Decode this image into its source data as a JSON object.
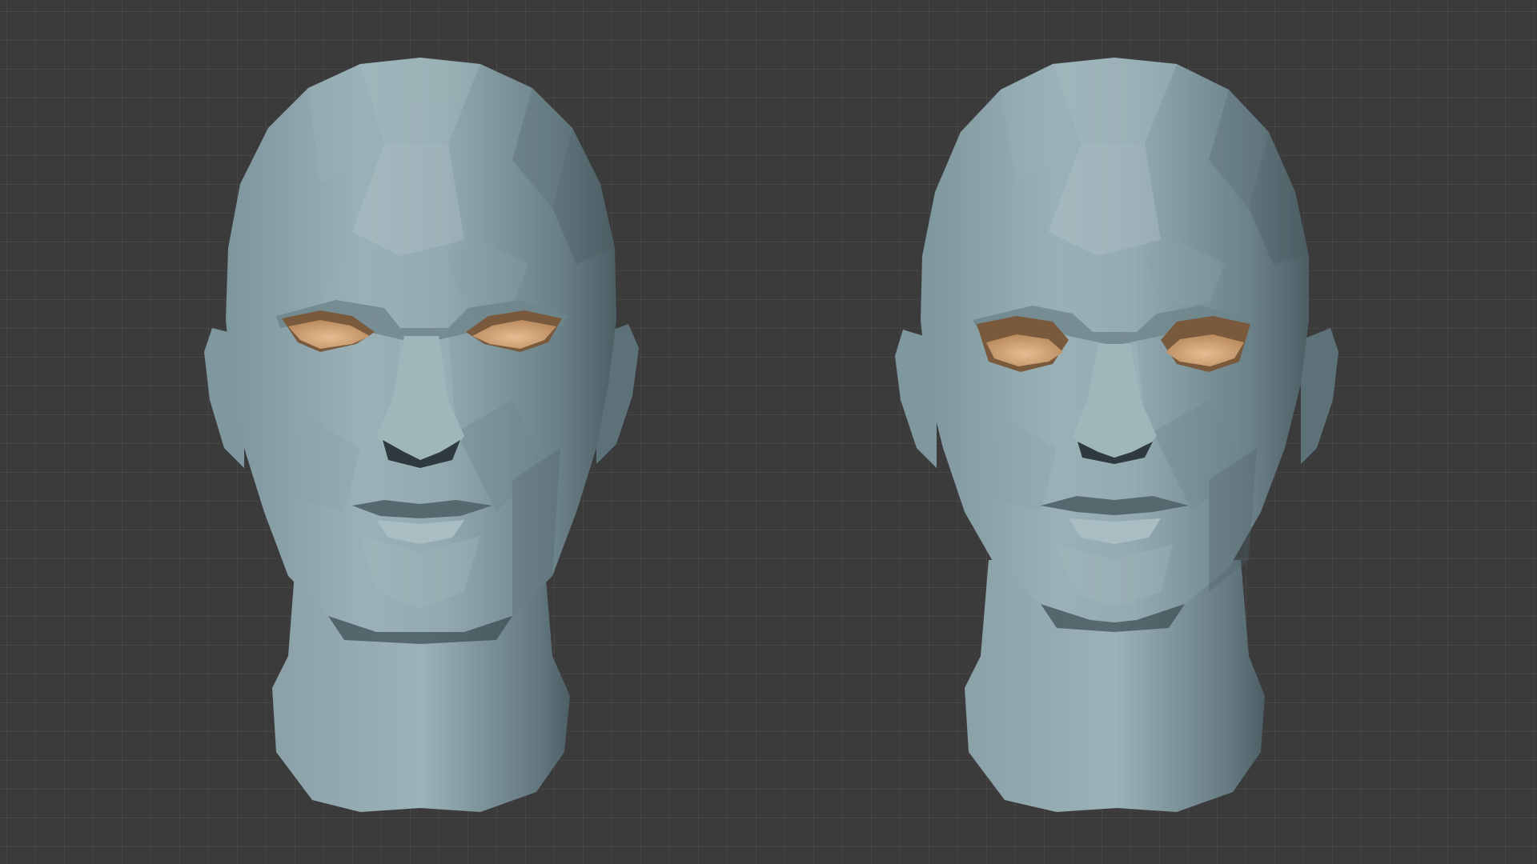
{
  "viewport": {
    "background_color": "#3b3b3c",
    "grid": true,
    "grid_color": "#474748"
  },
  "models": [
    {
      "name": "head-model-left",
      "skin_color": "#8fa6ac",
      "eye_color": "#d9a97a",
      "style": "low-poly"
    },
    {
      "name": "head-model-right",
      "skin_color": "#8fa6ac",
      "eye_color": "#d9a97a",
      "style": "low-poly"
    }
  ]
}
